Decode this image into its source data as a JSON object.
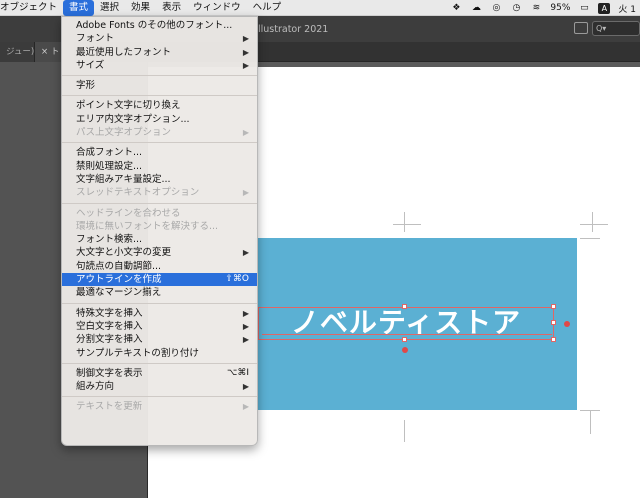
{
  "menubar": {
    "items": [
      "オブジェクト",
      "書式",
      "選択",
      "効果",
      "表示",
      "ウィンドウ",
      "ヘルプ"
    ],
    "active": "書式",
    "battery": "95%",
    "input_mode": "A",
    "day": "火 1"
  },
  "app": {
    "title": "llustrator 2021",
    "search_placeholder": "Q▾"
  },
  "tabs": [
    {
      "label": "ジュー)"
    },
    {
      "label": "× ト"
    }
  ],
  "artwork": {
    "text": "ノベルティストア",
    "fill_color": "#5bb0d3",
    "selection_color": "#e06666"
  },
  "menu": {
    "groups": [
      [
        {
          "label": "Adobe Fonts のその他のフォント...",
          "disabled": false,
          "submenu": false
        },
        {
          "label": "フォント",
          "disabled": false,
          "submenu": true
        },
        {
          "label": "最近使用したフォント",
          "disabled": false,
          "submenu": true
        },
        {
          "label": "サイズ",
          "disabled": false,
          "submenu": true
        }
      ],
      [
        {
          "label": "字形",
          "disabled": false,
          "submenu": false
        }
      ],
      [
        {
          "label": "ポイント文字に切り換え",
          "disabled": false,
          "submenu": false
        },
        {
          "label": "エリア内文字オプション...",
          "disabled": false,
          "submenu": false
        },
        {
          "label": "パス上文字オプション",
          "disabled": true,
          "submenu": true
        }
      ],
      [
        {
          "label": "合成フォント...",
          "disabled": false,
          "submenu": false
        },
        {
          "label": "禁則処理設定...",
          "disabled": false,
          "submenu": false
        },
        {
          "label": "文字組みアキ量設定...",
          "disabled": false,
          "submenu": false
        },
        {
          "label": "スレッドテキストオプション",
          "disabled": true,
          "submenu": true
        }
      ],
      [
        {
          "label": "ヘッドラインを合わせる",
          "disabled": true,
          "submenu": false
        },
        {
          "label": "環境に無いフォントを解決する...",
          "disabled": true,
          "submenu": false
        },
        {
          "label": "フォント検索...",
          "disabled": false,
          "submenu": false
        },
        {
          "label": "大文字と小文字の変更",
          "disabled": false,
          "submenu": true
        },
        {
          "label": "句読点の自動調節...",
          "disabled": false,
          "submenu": false
        },
        {
          "label": "アウトラインを作成",
          "disabled": false,
          "submenu": false,
          "highlight": true,
          "shortcut": "⇧⌘O"
        },
        {
          "label": "最適なマージン揃え",
          "disabled": false,
          "submenu": false
        }
      ],
      [
        {
          "label": "特殊文字を挿入",
          "disabled": false,
          "submenu": true
        },
        {
          "label": "空白文字を挿入",
          "disabled": false,
          "submenu": true
        },
        {
          "label": "分割文字を挿入",
          "disabled": false,
          "submenu": true
        },
        {
          "label": "サンプルテキストの割り付け",
          "disabled": false,
          "submenu": false
        }
      ],
      [
        {
          "label": "制御文字を表示",
          "disabled": false,
          "submenu": false,
          "shortcut": "⌥⌘I"
        },
        {
          "label": "組み方向",
          "disabled": false,
          "submenu": true
        }
      ],
      [
        {
          "label": "テキストを更新",
          "disabled": true,
          "submenu": true
        }
      ]
    ]
  }
}
